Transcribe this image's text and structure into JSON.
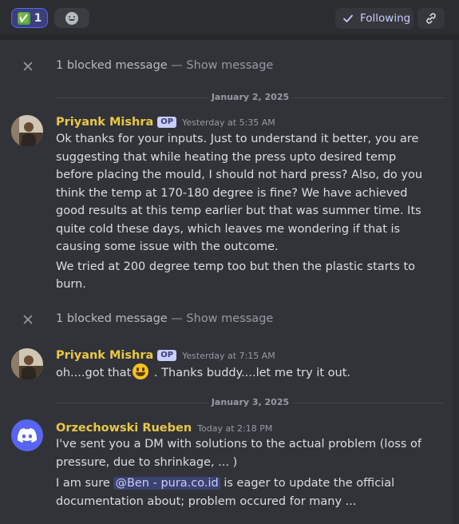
{
  "toolbar": {
    "reaction_count": "1",
    "reaction_emoji": "✅",
    "add_reaction_icon": "smile-plus-icon",
    "following_label": "Following",
    "following_icon": "check-icon",
    "link_icon": "link-icon"
  },
  "blocked": {
    "text": "1 blocked message",
    "separator": " — ",
    "show_label": "Show message"
  },
  "dates": {
    "first": "January 2, 2025",
    "second": "January 3, 2025"
  },
  "messages": [
    {
      "author": "Priyank Mishra",
      "badge": "OP",
      "timestamp": "Yesterday at 5:35 AM",
      "paragraphs": [
        "Ok thanks for your inputs. Just to understand it better, you are suggesting that while heating the press upto desired temp before placing the mould, I should not hard press? Also, do you think the temp at 170-180 degree is fine? We have achieved good results at this temp earlier but that was summer time. Its quite cold these days, which leaves me wondering if that is causing some issue with the outcome.",
        "We tried at 200 degree temp too but then the plastic starts to burn."
      ]
    },
    {
      "author": "Priyank Mishra",
      "badge": "OP",
      "timestamp": "Yesterday at 7:15 AM",
      "text_before": "oh....got that",
      "text_after": " . Thanks buddy....let me try it out."
    },
    {
      "author": "Orzechowski Rueben",
      "timestamp": "Today at 2:18 PM",
      "paragraph1": "I've sent you a DM with solutions to the actual problem (loss of pressure, due to shrinkage, ... )",
      "p2_before": "I am sure ",
      "mention": "@Ben - pura.co.id",
      "p2_after": " is eager to update the official documentation about; problem occured for many ..."
    }
  ]
}
